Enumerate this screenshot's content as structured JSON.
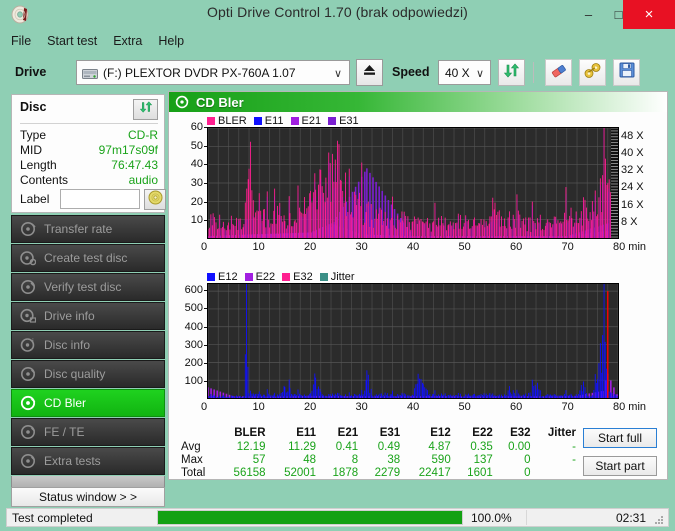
{
  "window": {
    "title": "Opti Drive Control 1.70 (brak odpowiedzi)",
    "app_icon": "disc-icon",
    "minimize_glyph": "–",
    "maximize_glyph": "□",
    "close_glyph": "×",
    "titlebar_color": "#8fcfb4",
    "close_color": "#e81123"
  },
  "menu": {
    "items": [
      {
        "label": "File"
      },
      {
        "label": "Start test"
      },
      {
        "label": "Extra"
      },
      {
        "label": "Help"
      }
    ]
  },
  "toolbar": {
    "drive_label": "Drive",
    "drive_value": "(F:)  PLEXTOR DVDR  PX-760A 1.07",
    "drive_caret": "∨",
    "eject_icon": "eject-icon",
    "speed_label": "Speed",
    "speed_value": "40 X",
    "speed_caret": "∨",
    "refresh_icon": "refresh-icon",
    "erase_icon": "eraser-icon",
    "tools_icon": "tools-icon",
    "save_icon": "save-floppy-icon"
  },
  "disc_panel": {
    "title": "Disc",
    "refresh_icon": "refresh-icon",
    "rows": [
      {
        "key": "Type",
        "value": "CD-R"
      },
      {
        "key": "MID",
        "value": "97m17s09f"
      },
      {
        "key": "Length",
        "value": "76:47.43"
      },
      {
        "key": "Contents",
        "value": "audio"
      }
    ],
    "label_key": "Label",
    "label_value": "",
    "label_placeholder": "",
    "disc_button_icon": "cd-disc-icon",
    "value_color": "#1aa31a"
  },
  "sidebar": {
    "items": [
      {
        "label": "Transfer rate",
        "icon": "disc-test-icon",
        "active": false
      },
      {
        "label": "Create test disc",
        "icon": "disc-write-icon",
        "active": false
      },
      {
        "label": "Verify test disc",
        "icon": "disc-verify-icon",
        "active": false
      },
      {
        "label": "Drive info",
        "icon": "disc-drive-icon",
        "active": false
      },
      {
        "label": "Disc info",
        "icon": "disc-info-icon",
        "active": false
      },
      {
        "label": "Disc quality",
        "icon": "disc-quality-icon",
        "active": false
      },
      {
        "label": "CD Bler",
        "icon": "disc-bler-icon",
        "active": true
      },
      {
        "label": "FE / TE",
        "icon": "disc-fete-icon",
        "active": false
      },
      {
        "label": "Extra tests",
        "icon": "disc-extra-icon",
        "active": false
      }
    ],
    "status_window_label": "Status window > >",
    "active_color": "#17c217"
  },
  "main": {
    "header_title": "CD Bler",
    "header_icon": "disc-bler-icon",
    "start_full_label": "Start full",
    "start_part_label": "Start part"
  },
  "statusbar": {
    "status_text": "Test completed",
    "progress_percent": 100.0,
    "progress_label": "100.0%",
    "elapsed_time": "02:31",
    "progress_color": "#13a113"
  },
  "stats": {
    "columns": [
      "BLER",
      "E11",
      "E21",
      "E31",
      "E12",
      "E22",
      "E32",
      "Jitter"
    ],
    "rows": [
      {
        "label": "Avg",
        "values": [
          "12.19",
          "11.29",
          "0.41",
          "0.49",
          "4.87",
          "0.35",
          "0.00",
          "-"
        ]
      },
      {
        "label": "Max",
        "values": [
          "57",
          "48",
          "8",
          "38",
          "590",
          "137",
          "0",
          "-"
        ]
      },
      {
        "label": "Total",
        "values": [
          "56158",
          "52001",
          "1878",
          "2279",
          "22417",
          "1601",
          "0",
          ""
        ]
      }
    ]
  },
  "chart_data": [
    {
      "id": "cd-bler-chart",
      "type": "area",
      "title": "CD Bler",
      "xlabel": "min",
      "ylabel": "",
      "xlim": [
        0,
        80
      ],
      "ylim": [
        0,
        60
      ],
      "xticks": [
        0,
        10,
        20,
        30,
        40,
        50,
        60,
        70,
        80
      ],
      "yticks": [
        10,
        20,
        30,
        40,
        50,
        60
      ],
      "right_axis_label": "X",
      "right_ticks": [
        "48 X",
        "40 X",
        "32 X",
        "24 X",
        "16 X",
        "8 X"
      ],
      "right_tick_values": [
        48,
        40,
        32,
        24,
        16,
        8
      ],
      "right_lim": [
        0,
        52
      ],
      "grid": true,
      "legend_position": "top-left",
      "background": "#2b2b2b",
      "legend": [
        {
          "name": "BLER",
          "color": "#ff1f8f"
        },
        {
          "name": "E11",
          "color": "#1010ff"
        },
        {
          "name": "E21",
          "color": "#a11fe0"
        },
        {
          "name": "E31",
          "color": "#7a1fd0"
        }
      ],
      "series": [
        {
          "name": "BLER",
          "color": "#ff1f8f",
          "x": [
            0,
            1,
            2,
            3,
            4,
            5,
            6,
            7,
            8,
            9,
            10,
            11,
            12,
            13,
            14,
            15,
            16,
            17,
            18,
            19,
            20,
            21,
            22,
            23,
            24,
            25,
            26,
            27,
            28,
            29,
            30,
            31,
            32,
            33,
            34,
            35,
            36,
            37,
            38,
            39,
            40,
            41,
            42,
            43,
            44,
            45,
            46,
            47,
            48,
            49,
            50,
            51,
            52,
            53,
            54,
            55,
            56,
            57,
            58,
            59,
            60,
            61,
            62,
            63,
            64,
            65,
            66,
            67,
            68,
            69,
            70,
            71,
            72,
            73,
            74,
            75,
            76,
            77,
            78,
            79,
            80
          ],
          "values": [
            14,
            11,
            13,
            10,
            12,
            9,
            11,
            15,
            57,
            13,
            12,
            14,
            11,
            13,
            17,
            12,
            11,
            13,
            15,
            20,
            24,
            30,
            38,
            44,
            41,
            46,
            38,
            34,
            28,
            24,
            20,
            18,
            16,
            14,
            13,
            12,
            11,
            10,
            12,
            11,
            10,
            9,
            11,
            10,
            9,
            10,
            11,
            9,
            10,
            11,
            13,
            11,
            10,
            9,
            8,
            10,
            24,
            11,
            10,
            12,
            11,
            13,
            10,
            9,
            11,
            10,
            9,
            10,
            11,
            12,
            14,
            13,
            16,
            18,
            20,
            22,
            26,
            34,
            57,
            12,
            8
          ]
        },
        {
          "name": "E11",
          "color": "#1010ff",
          "x": [
            0,
            1,
            2,
            3,
            4,
            5,
            6,
            7,
            8,
            9,
            10,
            11,
            12,
            13,
            14,
            15,
            16,
            17,
            18,
            19,
            20,
            21,
            22,
            23,
            24,
            25,
            26,
            27,
            28,
            29,
            30,
            31,
            32,
            33,
            34,
            35,
            36,
            37,
            38,
            39,
            40,
            41,
            42,
            43,
            44,
            45,
            46,
            47,
            48,
            49,
            50,
            51,
            52,
            53,
            54,
            55,
            56,
            57,
            58,
            59,
            60,
            61,
            62,
            63,
            64,
            65,
            66,
            67,
            68,
            69,
            70,
            71,
            72,
            73,
            74,
            75,
            76,
            77,
            78,
            79,
            80
          ],
          "values": [
            12,
            10,
            11,
            9,
            10,
            8,
            10,
            13,
            16,
            11,
            10,
            12,
            10,
            11,
            15,
            11,
            10,
            11,
            13,
            17,
            21,
            26,
            33,
            40,
            36,
            41,
            33,
            30,
            25,
            21,
            18,
            16,
            14,
            12,
            11,
            10,
            10,
            9,
            11,
            10,
            9,
            8,
            10,
            9,
            8,
            9,
            10,
            8,
            9,
            10,
            12,
            10,
            9,
            8,
            7,
            9,
            14,
            10,
            9,
            11,
            10,
            11,
            9,
            8,
            10,
            9,
            8,
            9,
            10,
            11,
            12,
            12,
            14,
            16,
            18,
            20,
            23,
            30,
            48,
            10,
            7
          ]
        },
        {
          "name": "E21",
          "color": "#a11fe0",
          "x": [
            0,
            10,
            20,
            24,
            30,
            40,
            50,
            60,
            70,
            78,
            80
          ],
          "values": [
            1,
            2,
            3,
            8,
            2,
            1,
            1,
            1,
            1,
            4,
            1
          ]
        },
        {
          "name": "E31",
          "color": "#7a1fd0",
          "x": [
            0,
            8,
            20,
            24,
            31,
            40,
            50,
            62,
            70,
            78,
            80
          ],
          "values": [
            1,
            2,
            3,
            6,
            38,
            1,
            1,
            1,
            1,
            8,
            1
          ]
        }
      ]
    },
    {
      "id": "cd-bler-e1x-chart",
      "type": "bar",
      "title": "",
      "xlabel": "min",
      "ylabel": "",
      "xlim": [
        0,
        80
      ],
      "ylim": [
        0,
        640
      ],
      "xticks": [
        0,
        10,
        20,
        30,
        40,
        50,
        60,
        70,
        80
      ],
      "yticks": [
        100,
        200,
        300,
        400,
        500,
        600
      ],
      "grid": true,
      "legend_position": "top-left",
      "background": "#2b2b2b",
      "legend": [
        {
          "name": "E12",
          "color": "#1010ff"
        },
        {
          "name": "E22",
          "color": "#a11fe0"
        },
        {
          "name": "E32",
          "color": "#ff1f8f"
        },
        {
          "name": "Jitter",
          "color": "#3b8f86"
        }
      ],
      "series": [
        {
          "name": "E12",
          "color": "#1010ff",
          "x": [
            0,
            1,
            2,
            3,
            4,
            5,
            6,
            7,
            7.5,
            8,
            9,
            10,
            11,
            12,
            13,
            14,
            15,
            16,
            17,
            18,
            19,
            20,
            21,
            22,
            23,
            24,
            25,
            26,
            27,
            28,
            29,
            30,
            31,
            32,
            33,
            34,
            35,
            36,
            37,
            38,
            39,
            40,
            41,
            42,
            43,
            44,
            45,
            46,
            47,
            48,
            49,
            50,
            51,
            52,
            53,
            54,
            55,
            56,
            57,
            58,
            59,
            60,
            61,
            62,
            63,
            64,
            65,
            66,
            67,
            68,
            69,
            70,
            71,
            72,
            73,
            74,
            75,
            76,
            77,
            77.5,
            78,
            79,
            80
          ],
          "values": [
            30,
            15,
            12,
            18,
            10,
            14,
            12,
            20,
            590,
            40,
            22,
            18,
            16,
            30,
            14,
            20,
            80,
            45,
            28,
            20,
            16,
            24,
            130,
            35,
            18,
            22,
            26,
            18,
            20,
            30,
            18,
            22,
            150,
            25,
            18,
            22,
            30,
            20,
            18,
            24,
            16,
            20,
            110,
            100,
            30,
            22,
            18,
            26,
            20,
            18,
            24,
            16,
            30,
            20,
            18,
            22,
            24,
            18,
            16,
            20,
            60,
            24,
            18,
            22,
            26,
            110,
            20,
            18,
            24,
            16,
            20,
            22,
            18,
            24,
            100,
            20,
            18,
            210,
            350,
            300,
            60,
            24,
            18
          ]
        },
        {
          "name": "E22",
          "color": "#a11fe0",
          "x": [
            0,
            5,
            13,
            20,
            29,
            36,
            44,
            52,
            60,
            68,
            72,
            77,
            78,
            80
          ],
          "values": [
            60,
            10,
            8,
            12,
            10,
            9,
            11,
            8,
            10,
            9,
            12,
            40,
            137,
            8
          ]
        },
        {
          "name": "E32",
          "color": "#ff1f8f",
          "x": [
            0,
            20,
            40,
            60,
            78,
            80
          ],
          "values": [
            0,
            0,
            0,
            0,
            0,
            0
          ]
        },
        {
          "name": "Jitter",
          "color": "#3b8f86",
          "x": [],
          "values": []
        }
      ],
      "markers": [
        {
          "type": "vline",
          "x": 78,
          "color": "#ff0000",
          "y": 600
        }
      ]
    }
  ]
}
